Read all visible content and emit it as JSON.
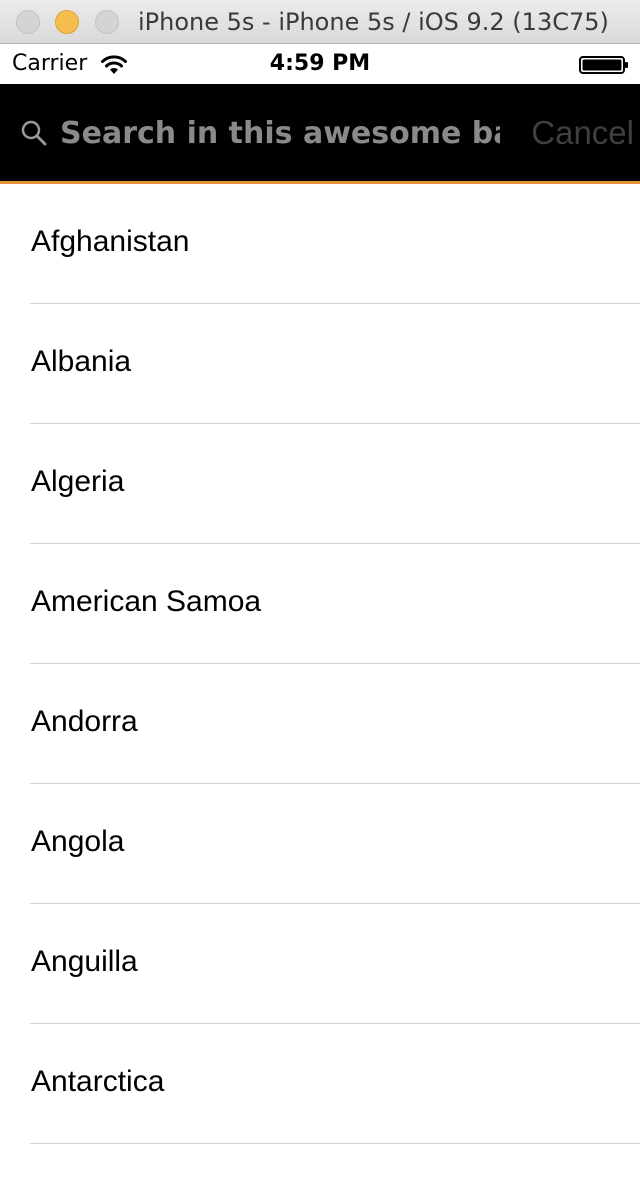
{
  "window": {
    "title": "iPhone 5s - iPhone 5s / iOS 9.2 (13C75)"
  },
  "status_bar": {
    "carrier": "Carrier",
    "time": "4:59 PM",
    "icons": [
      "wifi-icon",
      "battery-icon"
    ]
  },
  "search": {
    "placeholder": "Search in this awesome bar...",
    "value": "",
    "cancel_label": "Cancel",
    "icon": "search-icon",
    "accent_color": "#e6913a"
  },
  "countries": [
    {
      "name": "Afghanistan"
    },
    {
      "name": "Albania"
    },
    {
      "name": "Algeria"
    },
    {
      "name": "American Samoa"
    },
    {
      "name": "Andorra"
    },
    {
      "name": "Angola"
    },
    {
      "name": "Anguilla"
    },
    {
      "name": "Antarctica"
    }
  ]
}
